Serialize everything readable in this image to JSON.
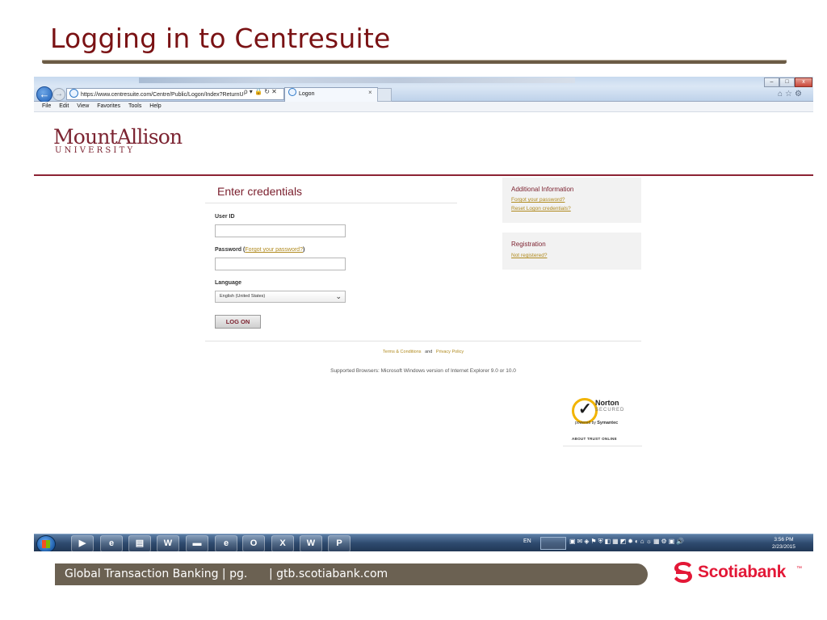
{
  "slide": {
    "title": "Logging in to Centresuite",
    "footer_left": "Global Transaction Banking | pg.",
    "footer_right": "| gtb.scotiabank.com",
    "brand": "Scotiabank",
    "brand_tm": "™",
    "title_color": "#7a1214",
    "brand_color": "#e31837"
  },
  "browser": {
    "back_glyph": "←",
    "forward_glyph": "→",
    "address_url": "https://www.centresuite.com/Centre/Public/Logon/Index?ReturnU",
    "address_tools": "ρ ▾ 🔒 ↻ ✕",
    "tab_title": "Logon",
    "tab_close": "×",
    "window_buttons": [
      "–",
      "□",
      "x"
    ],
    "right_icons": "⌂☆⚙",
    "menu": [
      "File",
      "Edit",
      "View",
      "Favorites",
      "Tools",
      "Help"
    ]
  },
  "page": {
    "logo_main": "MountAllison",
    "logo_sub": "UNIVERSITY",
    "heading": "Enter credentials",
    "user_id_label": "User ID",
    "password_label": "Password",
    "password_paren_open": "(",
    "password_link": "Forgot your password?",
    "password_paren_close": ")",
    "language_label": "Language",
    "language_value": "English (United States)",
    "logon_button": "LOG ON",
    "additional_title": "Additional Information",
    "additional_links": [
      "Forgot your password?",
      "Reset Logon credentials?"
    ],
    "registration_title": "Registration",
    "registration_link": "Not registered?",
    "terms_link": "Terms & Conditions",
    "and_text": "and",
    "privacy_link": "Privacy Policy",
    "supported_browsers": "Supported Browsers: Microsoft Windows version of Internet Explorer 9.0 or 10.0",
    "norton_brand": "Norton",
    "norton_secured": "SECURED",
    "norton_powered": "powered by",
    "norton_symantec": "Symantec",
    "norton_about": "ABOUT TRUST ONLINE",
    "accent_color": "#8c2334",
    "link_color": "#b08a1f"
  },
  "taskbar": {
    "pinned": [
      "▶",
      "e",
      "▤",
      "W",
      "▬",
      "e",
      "O",
      "X",
      "W",
      "P"
    ],
    "language": "EN",
    "tray_icons": "▣✉◈⚑⛨◧▦◩✹◐⌂☼▦⚙▣🔊",
    "time": "3:56 PM",
    "date": "2/23/2015"
  }
}
